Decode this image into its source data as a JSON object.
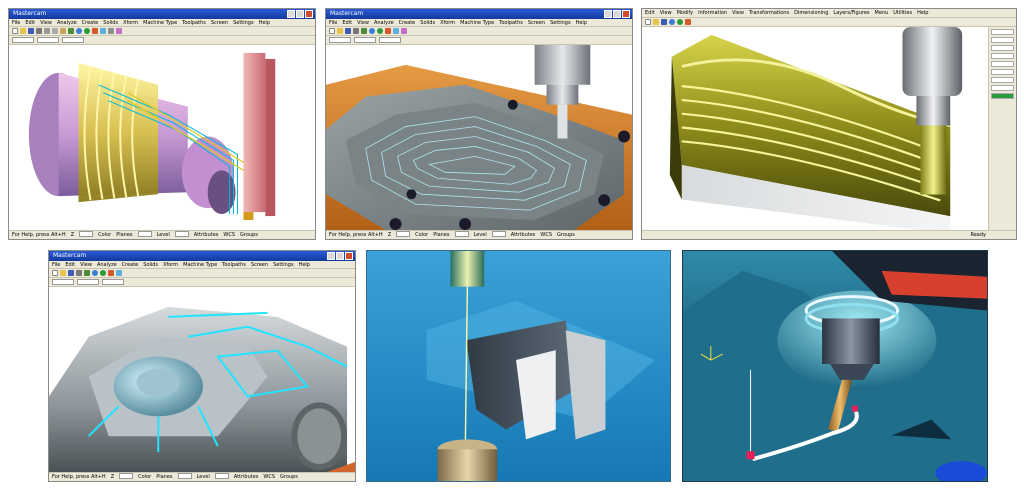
{
  "windows": {
    "top_left": {
      "title": "Mastercam",
      "menu": [
        "File",
        "Edit",
        "View",
        "Analyze",
        "Create",
        "Solids",
        "Xform",
        "Machine Type",
        "Toolpaths",
        "Screen",
        "Settings",
        "Help"
      ],
      "status_left": "For Help, press Alt+H",
      "status_fields": [
        "Z",
        "Color",
        "Planes",
        "Level",
        "Attributes",
        "WCS",
        "Groups"
      ]
    },
    "top_middle": {
      "title": "Mastercam",
      "menu": [
        "File",
        "Edit",
        "View",
        "Analyze",
        "Create",
        "Solids",
        "Xform",
        "Machine Type",
        "Toolpaths",
        "Screen",
        "Settings",
        "Help"
      ],
      "status_left": "For Help, press Alt+H",
      "status_fields": [
        "Z",
        "Color",
        "Planes",
        "Level",
        "Attributes",
        "WCS",
        "Groups"
      ]
    },
    "top_right": {
      "title": "",
      "menu": [
        "Edit",
        "View",
        "Modify",
        "Information",
        "View",
        "Transformations",
        "Dimensioning",
        "Layers/Figures",
        "Menu",
        "Utilities",
        "Help"
      ],
      "status_right": "Ready"
    },
    "bottom_left": {
      "title": "Mastercam",
      "menu": [
        "File",
        "Edit",
        "View",
        "Analyze",
        "Create",
        "Solids",
        "Xform",
        "Machine Type",
        "Toolpaths",
        "Screen",
        "Settings",
        "Help"
      ],
      "status_left": "For Help, press Alt+H",
      "status_fields": [
        "Z",
        "Color",
        "Planes",
        "Level",
        "Attributes",
        "WCS",
        "Groups"
      ]
    }
  },
  "colors": {
    "title_bar": "#1f4fc4",
    "chrome": "#ece9d8",
    "wire_bg_blue": "#1f8ec4",
    "render_bg_teal": "#1a6a86",
    "stock_orange": "#d2822a",
    "tool_gray": "#b8bcc4",
    "toolpath_cyan": "#33e0ff"
  }
}
